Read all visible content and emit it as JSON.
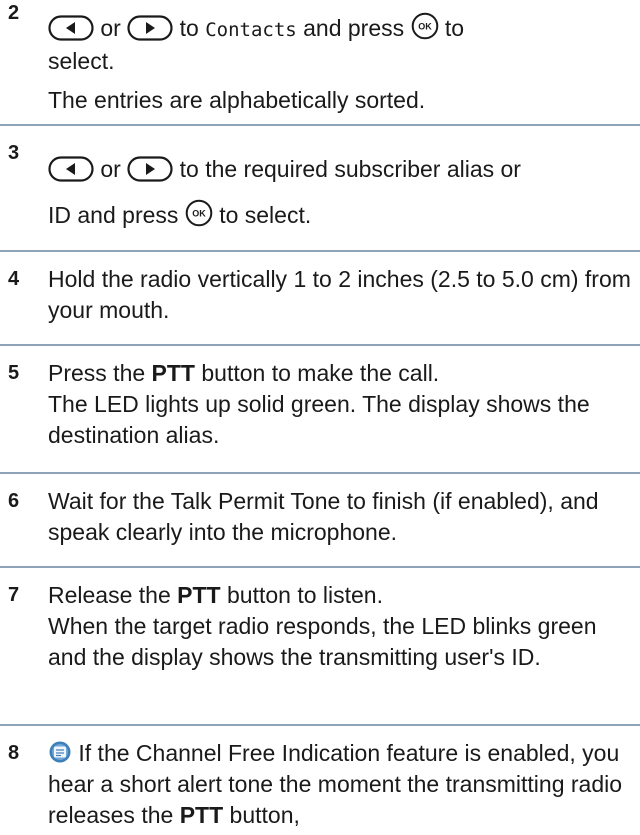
{
  "icons": {
    "left": "left-arrow-key-icon",
    "right": "right-arrow-key-icon",
    "ok": "ok-button-icon",
    "info": "channel-free-indication-icon"
  },
  "colors": {
    "divider": "#8fa3b8",
    "text": "#1a1a1a",
    "info_icon": "#3d7fb8"
  },
  "steps": [
    {
      "number": "2",
      "or": "or",
      "to": "to",
      "menu": "Contacts",
      "and_press": "and press",
      "to2": "to",
      "select": "select.",
      "note": "The entries are alphabetically sorted."
    },
    {
      "number": "3",
      "or": "or",
      "line1_tail": "to the required subscriber alias or",
      "line2_head": "ID and press",
      "line2_tail": "to select."
    },
    {
      "number": "4",
      "text": "Hold the radio vertically 1 to 2 inches (2.5 to 5.0 cm) from your mouth."
    },
    {
      "number": "5",
      "pre": "Press the",
      "bold": "PTT",
      "post": "button to make the call.",
      "line2": "The LED lights up solid green. The display shows the destination alias."
    },
    {
      "number": "6",
      "text": "Wait for the Talk Permit Tone to finish (if enabled), and speak clearly into the microphone."
    },
    {
      "number": "7",
      "pre": "Release the",
      "bold": "PTT",
      "post": "button to listen.",
      "line2": "When the target radio responds, the LED blinks green and the display shows the transmitting user's ID."
    },
    {
      "number": "8",
      "pre": "If the Channel Free Indication feature is enabled, you hear a short alert tone the moment the transmitting radio releases the",
      "bold": "PTT",
      "post": "button,"
    }
  ]
}
